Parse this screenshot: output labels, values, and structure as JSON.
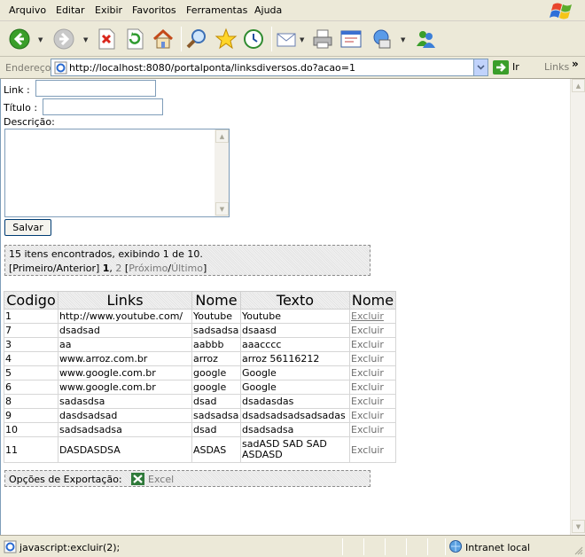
{
  "menu": {
    "items": [
      "Arquivo",
      "Editar",
      "Exibir",
      "Favoritos",
      "Ferramentas",
      "Ajuda"
    ]
  },
  "toolbar": {
    "icons": [
      "back-icon",
      "forward-icon",
      "stop-icon",
      "refresh-icon",
      "home-icon",
      "search-icon",
      "favorites-icon",
      "history-icon",
      "mail-icon",
      "print-icon",
      "edit-icon",
      "messenger-icon",
      "contacts-icon"
    ]
  },
  "address": {
    "label": "Endereço",
    "url": "http://localhost:8080/portalponta/linksdiversos.do?acao=1",
    "go_label": "Ir",
    "links_label": "Links",
    "links_chevron": "»"
  },
  "form": {
    "link_label": "Link :",
    "link_value": "",
    "title_label": "Título :",
    "title_value": "",
    "description_label": "Descrição:",
    "description_value": "",
    "save_label": "Salvar"
  },
  "pager": {
    "info": "15 itens encontrados, exibindo 1 de 10.",
    "first_prev": "[Primeiro/Anterior]",
    "current_page": "1",
    "separator": ",",
    "next_page": "2",
    "bracket_open": "[",
    "next_label": "Próximo",
    "slash": "/",
    "last_label": "Último",
    "bracket_close": "]"
  },
  "table": {
    "headers": [
      "Codigo",
      "Links",
      "Nome",
      "Texto",
      "Nome"
    ],
    "rows": [
      {
        "codigo": "1",
        "link": "http://www.youtube.com/",
        "nome": "Youtube",
        "texto": "Youtube",
        "action": "Excluir"
      },
      {
        "codigo": "7",
        "link": "dsadsad",
        "nome": "sadsadsa",
        "texto": "dsaasd",
        "action": "Excluir"
      },
      {
        "codigo": "3",
        "link": "aa",
        "nome": "aabbb",
        "texto": "aaacccc",
        "action": "Excluir"
      },
      {
        "codigo": "4",
        "link": "www.arroz.com.br",
        "nome": "arroz",
        "texto": "arroz 56116212",
        "action": "Excluir"
      },
      {
        "codigo": "5",
        "link": "www.google.com.br",
        "nome": "google",
        "texto": "Google",
        "action": "Excluir"
      },
      {
        "codigo": "6",
        "link": "www.google.com.br",
        "nome": "google",
        "texto": "Google",
        "action": "Excluir"
      },
      {
        "codigo": "8",
        "link": "sadasdsa",
        "nome": "dsad",
        "texto": "dsadasdas",
        "action": "Excluir"
      },
      {
        "codigo": "9",
        "link": "dasdsadsad",
        "nome": "sadsadsa",
        "texto": "dsadsadsadsadsadas",
        "action": "Excluir"
      },
      {
        "codigo": "10",
        "link": "sadsadsadsa",
        "nome": "dsad",
        "texto": "dsadsadsa",
        "action": "Excluir"
      },
      {
        "codigo": "11",
        "link": "DASDASDSA",
        "nome": "ASDAS",
        "texto": "sadASD SAD SAD ASDASD",
        "action": "Excluir"
      }
    ]
  },
  "export": {
    "label": "Opções de Exportação:",
    "excel_label": "Excel"
  },
  "status": {
    "text": "javascript:excluir(2);",
    "zone": "Intranet local"
  },
  "colors": {
    "chrome": "#ece9d8",
    "input_border": "#7f9db9",
    "disabled_text": "#7a7a7a"
  }
}
